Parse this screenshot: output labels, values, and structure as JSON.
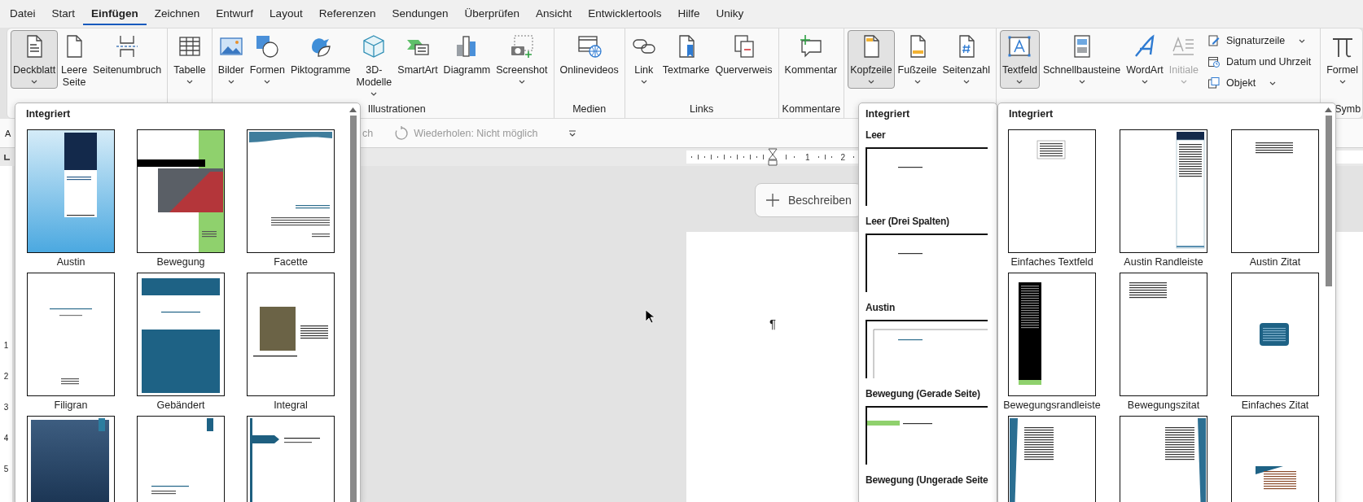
{
  "menu_tabs": [
    {
      "label": "Datei",
      "selected": false
    },
    {
      "label": "Start",
      "selected": false
    },
    {
      "label": "Einfügen",
      "selected": true
    },
    {
      "label": "Zeichnen",
      "selected": false
    },
    {
      "label": "Entwurf",
      "selected": false
    },
    {
      "label": "Layout",
      "selected": false
    },
    {
      "label": "Referenzen",
      "selected": false
    },
    {
      "label": "Sendungen",
      "selected": false
    },
    {
      "label": "Überprüfen",
      "selected": false
    },
    {
      "label": "Ansicht",
      "selected": false
    },
    {
      "label": "Entwicklertools",
      "selected": false
    },
    {
      "label": "Hilfe",
      "selected": false
    },
    {
      "label": "Uniky",
      "selected": false
    }
  ],
  "ribbon": {
    "groups": [
      {
        "buttons": [
          {
            "label": "Deckblatt",
            "kind": "large",
            "menu": true,
            "selected": true,
            "disabled": false
          },
          {
            "label": "Leere Seite",
            "kind": "large",
            "menu": false,
            "selected": false,
            "disabled": false
          },
          {
            "label": "Seitenumbruch",
            "kind": "large",
            "menu": false,
            "selected": false,
            "disabled": false
          }
        ]
      },
      {
        "buttons": [
          {
            "label": "Tabelle",
            "kind": "large",
            "menu": true,
            "selected": false,
            "disabled": false
          }
        ]
      },
      {
        "label": "Illustrationen",
        "buttons": [
          {
            "label": "Bilder",
            "kind": "large",
            "menu": true,
            "selected": false,
            "disabled": false
          },
          {
            "label": "Formen",
            "kind": "large",
            "menu": true,
            "selected": false,
            "disabled": false
          },
          {
            "label": "Piktogramme",
            "kind": "large",
            "menu": false,
            "selected": false,
            "disabled": false
          },
          {
            "label": "3D-Modelle",
            "kind": "large",
            "menu": true,
            "selected": false,
            "disabled": false
          },
          {
            "label": "SmartArt",
            "kind": "large",
            "menu": false,
            "selected": false,
            "disabled": false
          },
          {
            "label": "Diagramm",
            "kind": "large",
            "menu": false,
            "selected": false,
            "disabled": false
          },
          {
            "label": "Screenshot",
            "kind": "large",
            "menu": true,
            "selected": false,
            "disabled": false
          }
        ]
      },
      {
        "label": "Medien",
        "buttons": [
          {
            "label": "Onlinevideos",
            "kind": "large",
            "menu": false,
            "selected": false,
            "disabled": false
          }
        ]
      },
      {
        "label": "Links",
        "buttons": [
          {
            "label": "Link",
            "kind": "large",
            "menu": true,
            "selected": false,
            "disabled": false
          },
          {
            "label": "Textmarke",
            "kind": "large",
            "menu": false,
            "selected": false,
            "disabled": false
          },
          {
            "label": "Querverweis",
            "kind": "large",
            "menu": false,
            "selected": false,
            "disabled": false
          }
        ]
      },
      {
        "label": "Kommentare",
        "buttons": [
          {
            "label": "Kommentar",
            "kind": "large",
            "menu": false,
            "selected": false,
            "disabled": false
          }
        ]
      },
      {
        "buttons": [
          {
            "label": "Kopfzeile",
            "kind": "large",
            "menu": true,
            "selected": true,
            "disabled": false
          },
          {
            "label": "Fußzeile",
            "kind": "large",
            "menu": true,
            "selected": false,
            "disabled": false
          },
          {
            "label": "Seitenzahl",
            "kind": "large",
            "menu": true,
            "selected": false,
            "disabled": false
          }
        ]
      },
      {
        "buttons": [
          {
            "label": "Textfeld",
            "kind": "large",
            "menu": true,
            "selected": true,
            "disabled": false
          },
          {
            "label": "Schnellbausteine",
            "kind": "large",
            "menu": true,
            "selected": false,
            "disabled": false
          },
          {
            "label": "WordArt",
            "kind": "large",
            "menu": true,
            "selected": false,
            "disabled": false
          },
          {
            "label": "Initiale",
            "kind": "large",
            "menu": true,
            "selected": false,
            "disabled": true
          },
          {
            "label": "Signaturzeile",
            "kind": "small",
            "menu": true,
            "selected": false,
            "disabled": false
          },
          {
            "label": "Datum und Uhrzeit",
            "kind": "small",
            "menu": false,
            "selected": false,
            "disabled": false
          },
          {
            "label": "Objekt",
            "kind": "small",
            "menu": true,
            "selected": false,
            "disabled": false
          }
        ]
      },
      {
        "label": "Symb",
        "buttons": [
          {
            "label": "Formel",
            "kind": "large",
            "menu": true,
            "selected": false,
            "disabled": false
          }
        ]
      }
    ]
  },
  "quick_access": {
    "left_text": "A",
    "undo_text": "ch",
    "redo_label": "Wiederholen: Nicht möglich"
  },
  "ruler": {
    "labels": [
      "1",
      "2"
    ]
  },
  "vertical_ruler": {
    "labels": [
      "1",
      "2",
      "3",
      "4",
      "5"
    ]
  },
  "document": {
    "describe_button": "Beschreiben",
    "paragraph_mark": "¶"
  },
  "cover_gallery": {
    "heading": "Integriert",
    "items": [
      {
        "label": "Austin",
        "kind": "austin"
      },
      {
        "label": "Bewegung",
        "kind": "bewegung"
      },
      {
        "label": "Facette",
        "kind": "facette"
      },
      {
        "label": "Filigran",
        "kind": "filigran"
      },
      {
        "label": "Gebändert",
        "kind": "banded"
      },
      {
        "label": "Integral",
        "kind": "integral"
      },
      {
        "kind": "dark"
      },
      {
        "kind": "tab"
      },
      {
        "kind": "arrow"
      }
    ]
  },
  "header_gallery": {
    "heading": "Integriert",
    "sections": [
      {
        "title": "Leer",
        "kind": "plain"
      },
      {
        "title": "Leer (Drei Spalten)",
        "kind": "plain"
      },
      {
        "title": "Austin",
        "kind": "austin"
      },
      {
        "title": "Bewegung (Gerade Seite)",
        "kind": "bewegung"
      },
      {
        "title": "Bewegung (Ungerade Seite"
      }
    ]
  },
  "textbox_gallery": {
    "heading": "Integriert",
    "items": [
      {
        "label": "Einfaches Textfeld",
        "kind": "simple"
      },
      {
        "label": "Austin Randleiste",
        "kind": "navy-side"
      },
      {
        "label": "Austin Zitat",
        "kind": "quote-lines"
      },
      {
        "label": "Bewegungsrandleiste",
        "kind": "black-side"
      },
      {
        "label": "Bewegungszitat",
        "kind": "quote-left"
      },
      {
        "label": "Einfaches Zitat",
        "kind": "teal-box"
      },
      {
        "kind": "teal-left"
      },
      {
        "kind": "teal-right"
      },
      {
        "kind": "corner"
      }
    ]
  }
}
